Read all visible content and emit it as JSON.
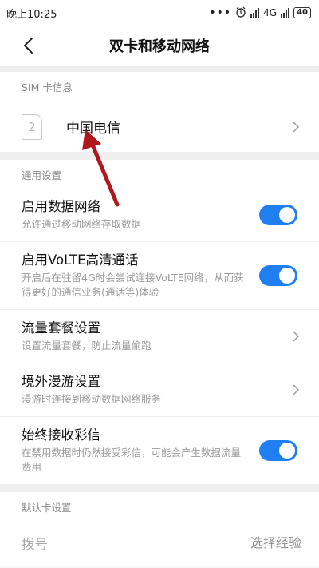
{
  "status": {
    "time": "晚上10:25",
    "network": "4G",
    "network_sup": "+",
    "battery": "40"
  },
  "header": {
    "title": "双卡和移动网络"
  },
  "sim_section": {
    "header": "SIM 卡信息",
    "slot_number": "2",
    "carrier": "中国电信"
  },
  "general": {
    "header": "通用设置",
    "items": [
      {
        "title": "启用数据网络",
        "subtitle": "允许通过移动网络存取数据"
      },
      {
        "title": "启用VoLTE高清通话",
        "subtitle": "开启后在驻留4G时会尝试连接VoLTE网络，从而获得更好的通信业务(通话等)体验"
      },
      {
        "title": "流量套餐设置",
        "subtitle": "设置流量套餐，防止流量偷跑"
      },
      {
        "title": "境外漫游设置",
        "subtitle": "漫游时连接到移动数据网络服务"
      },
      {
        "title": "始终接收彩信",
        "subtitle": "在禁用数据时仍然接受彩信，可能会产生数据流量费用"
      }
    ]
  },
  "default_card": {
    "header": "默认卡设置",
    "dial_label": "拨号",
    "dial_value": "选择经验"
  },
  "colors": {
    "accent": "#1f7ff1",
    "arrow": "#b0161c"
  }
}
